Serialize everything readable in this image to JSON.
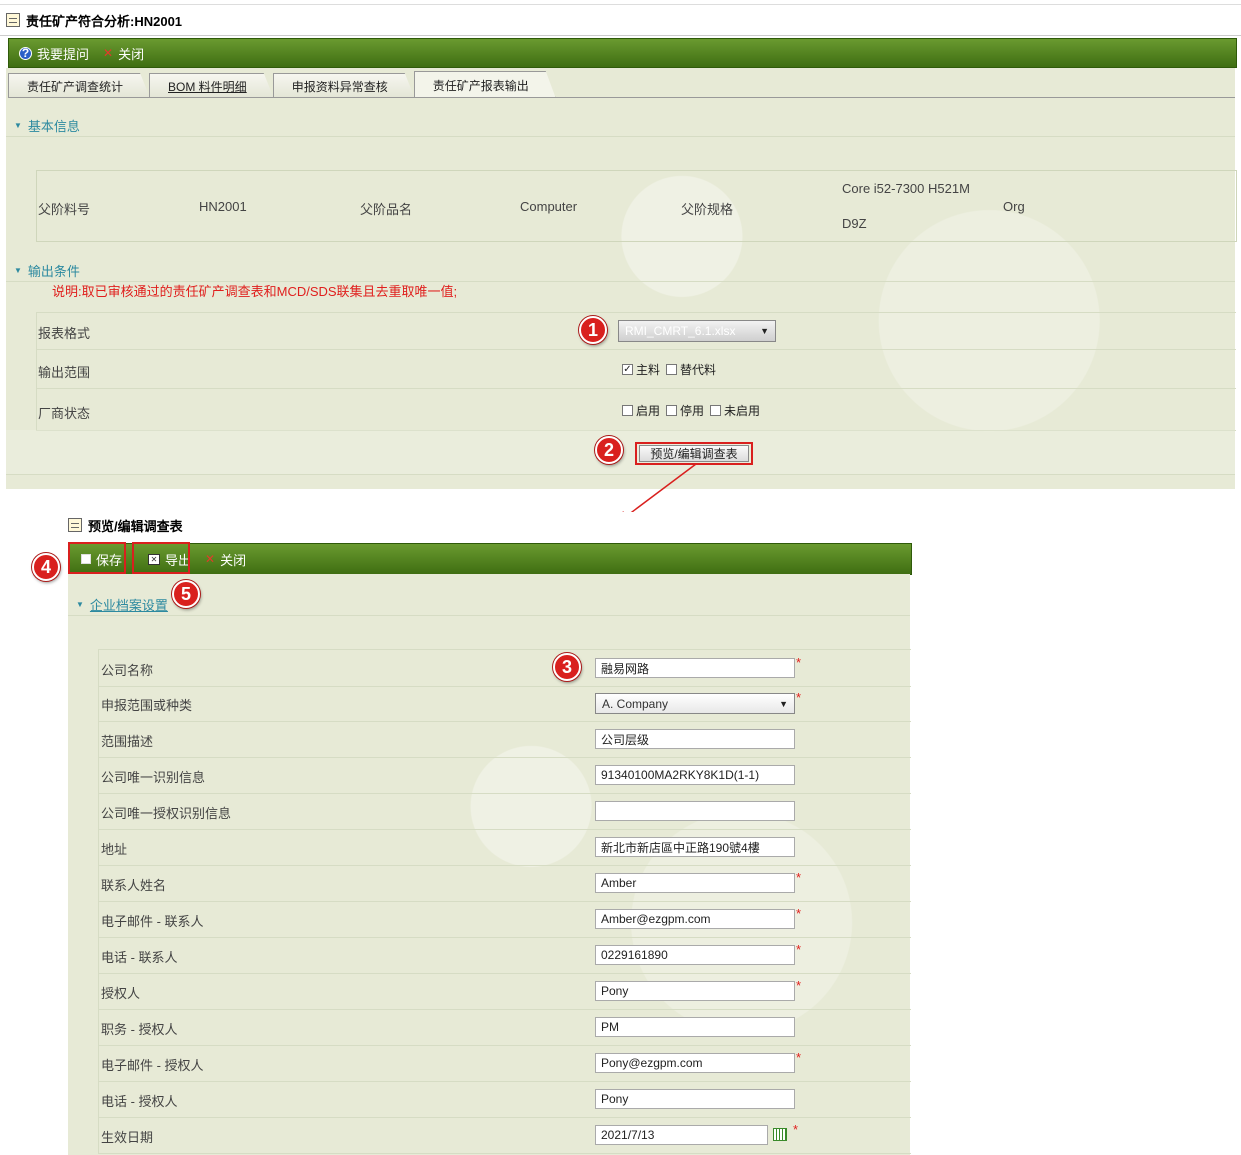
{
  "window1": {
    "title": "责任矿产符合分析:HN2001",
    "toolbar": {
      "help": "我要提问",
      "close": "关闭"
    },
    "tabs": [
      {
        "label": "责任矿产调查统计"
      },
      {
        "label": "BOM 料件明细"
      },
      {
        "label": "申报资料异常查核"
      },
      {
        "label": "责任矿产报表输出"
      }
    ],
    "basic_info": {
      "section_title": "基本信息",
      "parent_part_label": "父阶料号",
      "parent_part_value": "HN2001",
      "parent_name_label": "父阶品名",
      "parent_name_value": "Computer",
      "parent_spec_label": "父阶规格",
      "parent_spec_line1": "Core i52-7300 H521M",
      "parent_spec_line2": "D9Z",
      "parent_extra": "Org"
    },
    "output": {
      "section_title": "输出条件",
      "note": "说明:取已审核通过的责任矿产调查表和MCD/SDS联集且去重取唯一值;",
      "format_label": "报表格式",
      "format_value": "RMI_CMRT_6.1.xlsx",
      "range_label": "输出范围",
      "range_opt1": "主料",
      "range_opt2": "替代料",
      "vendor_label": "厂商状态",
      "vendor_opt1": "启用",
      "vendor_opt2": "停用",
      "vendor_opt3": "未启用",
      "preview_button": "预览/编辑调查表"
    }
  },
  "window2": {
    "title": "预览/编辑调查表",
    "toolbar": {
      "save": "保存",
      "export": "导出",
      "close": "关闭"
    },
    "section_title": "企业档案设置",
    "fields": [
      {
        "label": "公司名称",
        "value": "融易网路"
      },
      {
        "label": "申报范围或种类",
        "value": "A. Company"
      },
      {
        "label": "范围描述",
        "value": "公司层级"
      },
      {
        "label": "公司唯一识别信息",
        "value": "91340100MA2RKY8K1D(1-1)"
      },
      {
        "label": "公司唯一授权识别信息",
        "value": ""
      },
      {
        "label": "地址",
        "value": "新北市新店區中正路190號4樓"
      },
      {
        "label": "联系人姓名",
        "value": "Amber"
      },
      {
        "label": "电子邮件 - 联系人",
        "value": "Amber@ezgpm.com"
      },
      {
        "label": "电话 - 联系人",
        "value": "0229161890"
      },
      {
        "label": "授权人",
        "value": "Pony"
      },
      {
        "label": "职务 - 授权人",
        "value": "PM"
      },
      {
        "label": "电子邮件 - 授权人",
        "value": "Pony@ezgpm.com"
      },
      {
        "label": "电话 - 授权人",
        "value": "Pony"
      },
      {
        "label": "生效日期",
        "value": "2021/7/13"
      }
    ]
  },
  "badges": [
    "1",
    "2",
    "3",
    "4",
    "5"
  ],
  "colors": {
    "toolbar_green": "#4f7f1d",
    "accent_red": "#d9201e",
    "section_teal": "#2d8aa0",
    "panel_bg": "#e7ead6"
  }
}
